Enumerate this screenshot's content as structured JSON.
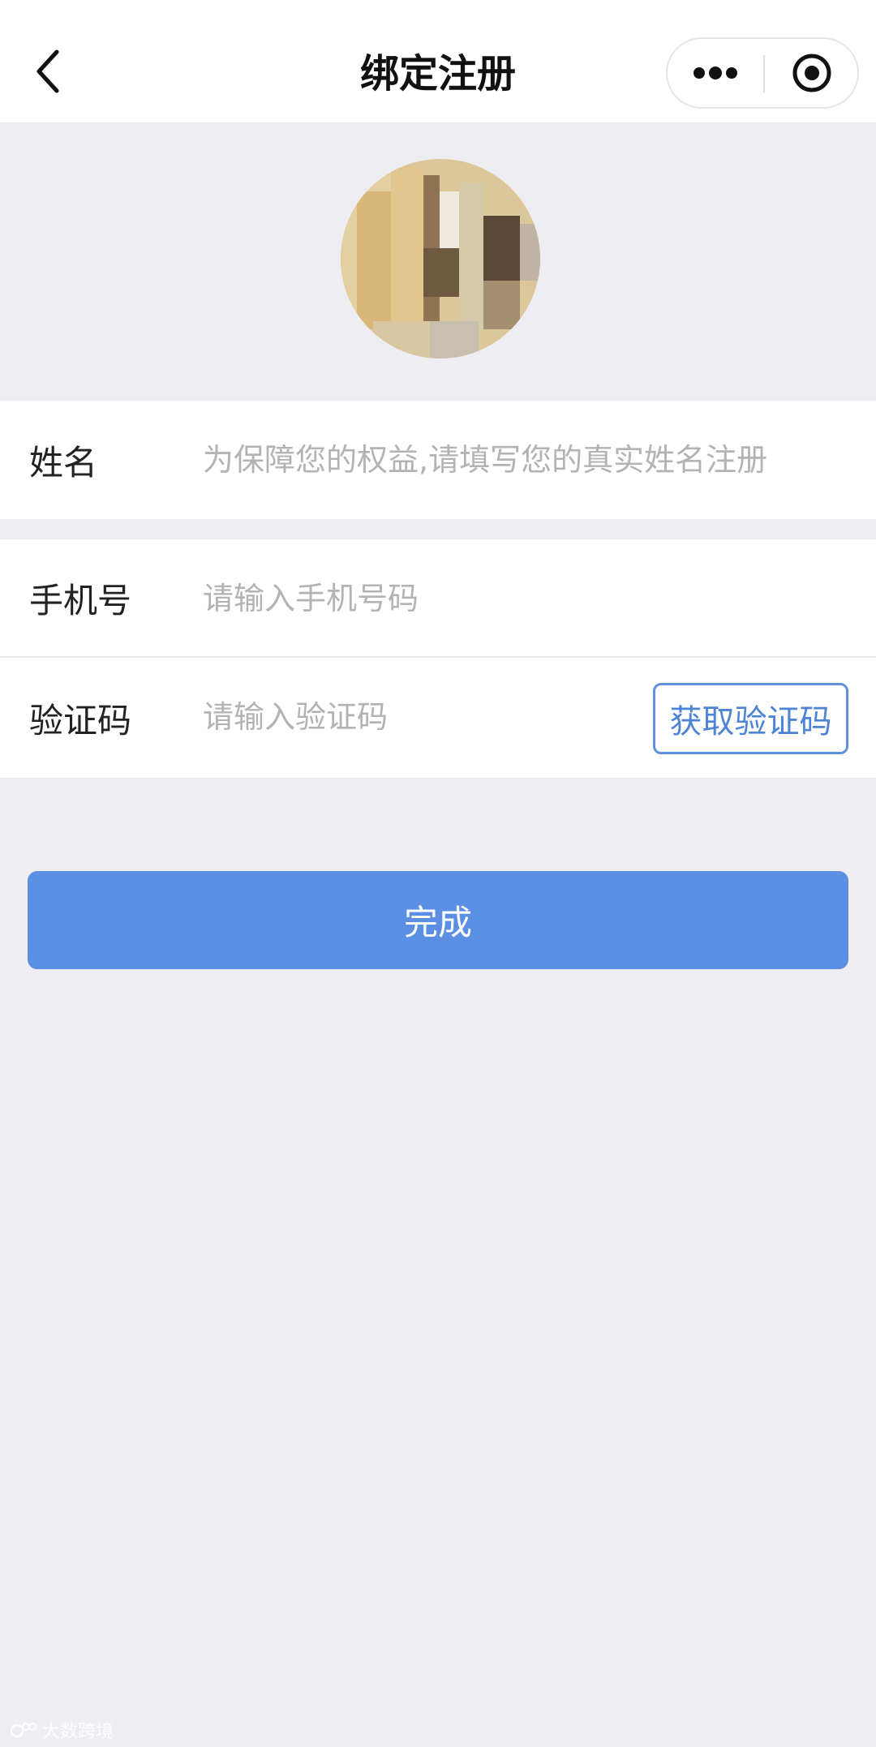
{
  "navbar": {
    "title": "绑定注册",
    "back_icon": "chevron-left-icon",
    "more_icon": "more-dots-icon",
    "close_icon": "target-close-icon"
  },
  "profile": {
    "avatar_icon": "avatar-pixelated"
  },
  "form": {
    "name": {
      "label": "姓名",
      "placeholder": "为保障您的权益,请填写您的真实姓名注册",
      "value": ""
    },
    "phone": {
      "label": "手机号",
      "placeholder": "请输入手机号码",
      "value": ""
    },
    "code": {
      "label": "验证码",
      "placeholder": "请输入验证码",
      "value": "",
      "get_code_label": "获取验证码"
    }
  },
  "actions": {
    "finish_label": "完成"
  },
  "watermark": {
    "text": "大数跨境"
  },
  "colors": {
    "page_bg": "#ededf2",
    "primary": "#5a8fe3",
    "link_blue": "#4d84d6",
    "placeholder": "#b3b3b3"
  }
}
